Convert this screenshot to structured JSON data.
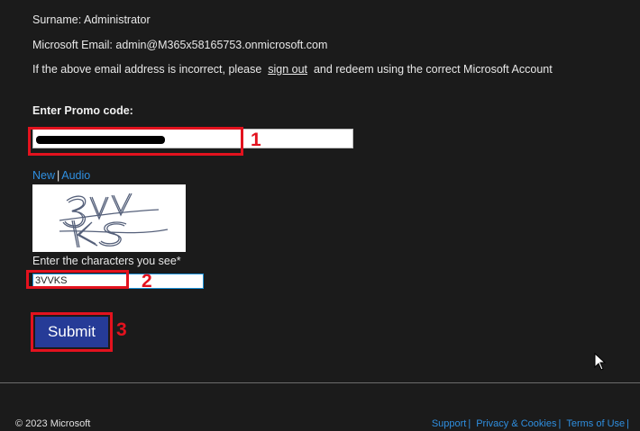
{
  "account": {
    "surname_label": "Surname:",
    "surname_value": "Administrator",
    "email_label": "Microsoft Email:",
    "email_value": "admin@M365x58165753.onmicrosoft.com",
    "incorrect_prefix": "If the above email address is incorrect, please",
    "signout_link": "sign out",
    "incorrect_suffix": "and redeem using the correct Microsoft Account"
  },
  "promo": {
    "label": "Enter Promo code:",
    "value": ""
  },
  "captcha": {
    "new_link": "New",
    "separator": "|",
    "audio_link": "Audio",
    "image_text": "3VVKS",
    "input_label": "Enter the characters you see*",
    "input_value": "3VVKS"
  },
  "submit_label": "Submit",
  "annotations": {
    "step1": "1",
    "step2": "2",
    "step3": "3",
    "highlight_color": "#e3121e"
  },
  "footer": {
    "copyright": "© 2023 Microsoft",
    "links": [
      "Support",
      "Privacy & Cookies",
      "Terms of Use"
    ],
    "separator": "|"
  },
  "colors": {
    "background": "#1b1b1b",
    "link": "#2f8fe0",
    "submit_bg": "#263b97"
  }
}
